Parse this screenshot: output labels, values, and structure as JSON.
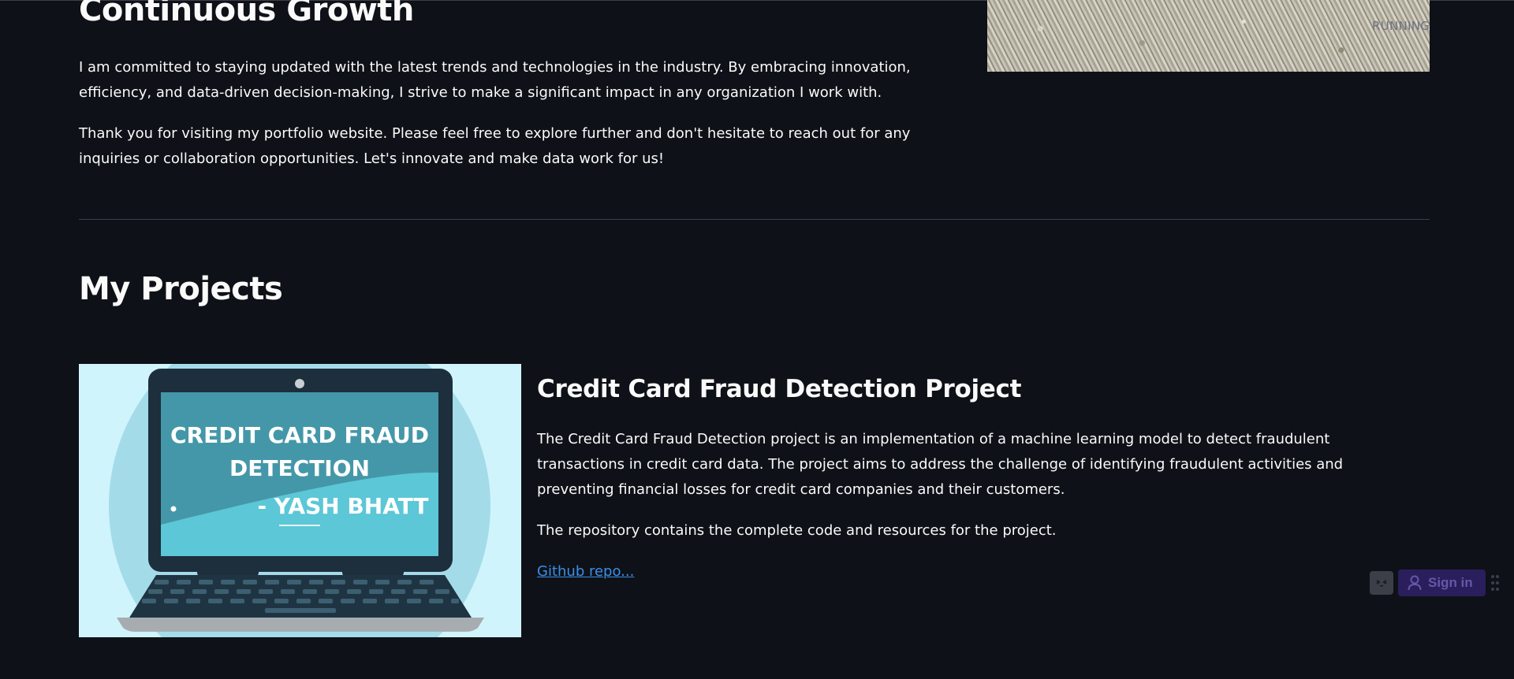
{
  "growth": {
    "title": "Continuous Growth",
    "p1": "I am committed to staying updated with the latest trends and technologies in the industry. By embracing innovation, efficiency, and data-driven decision-making, I strive to make a significant impact in any organization I work with.",
    "p2": "Thank you for visiting my portfolio website. Please feel free to explore further and don't hesitate to reach out for any inquiries or collaboration opportunities. Let's innovate and make data work for us!"
  },
  "status": {
    "running_label": "RUNNING"
  },
  "projects": {
    "title": "My Projects",
    "items": [
      {
        "title": "Credit Card Fraud Detection Project",
        "description": "The Credit Card Fraud Detection project is an implementation of a machine learning model to detect fraudulent transactions in credit card data. The project aims to address the challenge of identifying fraudulent activities and preventing financial losses for credit card companies and their customers.",
        "repo_text": "The repository contains the complete code and resources for the project.",
        "link_label": "Github repo...",
        "thumbnail": {
          "line1": "CREDIT CARD FRAUD",
          "line2": "DETECTION",
          "line3": "- YASH BHATT"
        }
      }
    ]
  },
  "widget": {
    "signin_label": "Sign in"
  },
  "colors": {
    "background": "#0e1117",
    "text": "#fafafa",
    "link": "#3b8fe8",
    "divider": "#3a3f4b",
    "signin_bg": "#2a1f5c"
  },
  "icons": [
    "face-icon",
    "user-icon",
    "grip-icon"
  ]
}
